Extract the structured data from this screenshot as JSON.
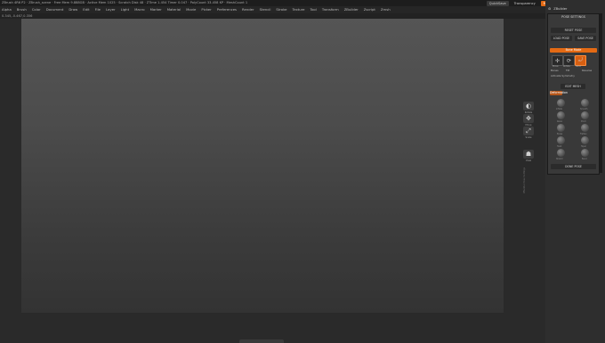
{
  "titlebar": {
    "title": "ZBrush 4R6 P2  · ZBrush_scene  · Free Mem 9.888GB  · Active Mem 1025  · Scratch Disk 48  · ZTime 1.454 Timer 0.047  · PolyCount 33.458 KP  · MeshCount 1",
    "buttons": [
      "QuickSave",
      "Transparency",
      "Menus",
      "DefaultZScript"
    ]
  },
  "menubar": [
    "Alpha",
    "Brush",
    "Color",
    "Document",
    "Draw",
    "Edit",
    "File",
    "Layer",
    "Light",
    "Macro",
    "Marker",
    "Material",
    "Movie",
    "Picker",
    "Preferences",
    "Render",
    "Stencil",
    "Stroke",
    "Texture",
    "Tool",
    "Transform",
    "ZBuilder",
    "Zscript",
    "Zmsh"
  ],
  "status": "0.345,-0.467,0.356",
  "right_shelf": {
    "buttons": [
      {
        "icon": "rotate-icon",
        "glyph": "◐",
        "label": "Rotate"
      },
      {
        "icon": "move-icon",
        "glyph": "✥",
        "label": "Move"
      },
      {
        "icon": "scale-icon",
        "glyph": "⤢",
        "label": "Scale"
      },
      {
        "icon": "view-icon",
        "glyph": "☗",
        "label": "View"
      }
    ],
    "vertical_text": "ZBuilder Pose Settings"
  },
  "panel": {
    "header": "ZBuilder",
    "section_title": "POSE SETTINGS",
    "reset_pose": "RESET POSE",
    "load_pose": "LOAD POSE",
    "save_pose": "SAVE POSE",
    "mode_bar": "Bone Mode",
    "tools": [
      {
        "icon": "move-bone-icon",
        "glyph": "✢",
        "label": "Move",
        "active": false
      },
      {
        "icon": "rotate-bone-icon",
        "glyph": "⟳",
        "label": "Rotate",
        "active": false
      },
      {
        "icon": "bend-bone-icon",
        "glyph": "⤾",
        "label": "Bend",
        "active": true
      }
    ],
    "bone_row": [
      "Bones",
      "Tilt",
      "Reverse"
    ],
    "symmetry": "Activate Symmetry",
    "edit_mesh": "EDIT MESH",
    "small_bar": "Deformation",
    "done_pose": "DONE POSE",
    "balls": [
      "Inflate",
      "Smooth",
      "Relax",
      "Pinch",
      "Bulge",
      "Flatten",
      "Twist",
      "Taper",
      "Stretch",
      "Bend"
    ]
  }
}
